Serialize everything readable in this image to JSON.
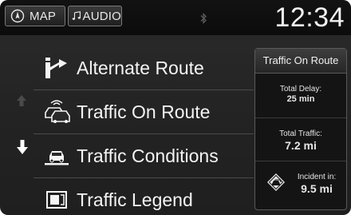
{
  "topbar": {
    "map_tab": {
      "label": "MAP",
      "icon": "compass-icon"
    },
    "audio_tab": {
      "label": "AUDIO",
      "icon": "music-note-icon"
    },
    "bluetooth_icon": "bluetooth-icon",
    "clock": "12:34"
  },
  "scroll": {
    "up_icon": "arrow-up-icon",
    "down_icon": "arrow-down-icon",
    "up_enabled": false,
    "down_enabled": true
  },
  "menu": {
    "items": [
      {
        "label": "Alternate Route",
        "icon": "alternate-route-icon"
      },
      {
        "label": "Traffic On Route",
        "icon": "traffic-on-route-icon"
      },
      {
        "label": "Traffic Conditions",
        "icon": "traffic-conditions-icon"
      },
      {
        "label": "Traffic Legend",
        "icon": "traffic-legend-icon"
      }
    ]
  },
  "panel": {
    "title": "Traffic On Route",
    "total_delay_label": "Total Delay:",
    "total_delay_value": "25 min",
    "total_traffic_label": "Total Traffic:",
    "total_traffic_value": "7.2 mi",
    "incident_label": "Incident in:",
    "incident_value": "9.5 mi",
    "incident_icon": "incident-warning-icon"
  },
  "colors": {
    "background": "#232323",
    "text": "#f4f4f4",
    "topbar": "#0c0c0c"
  }
}
